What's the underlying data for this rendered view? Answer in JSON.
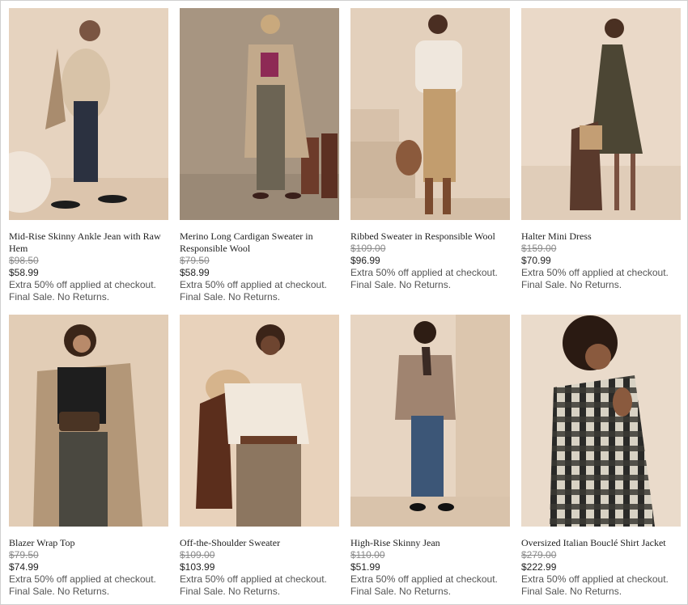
{
  "products": [
    {
      "name": "Mid-Rise Skinny Ankle Jean with Raw Hem",
      "original_price": "$98.50",
      "sale_price": "$58.99",
      "promo": "Extra 50% off applied at checkout.",
      "final": "Final Sale. No Returns.",
      "bg": "#e6d3bf",
      "figure": "#b99a7b"
    },
    {
      "name": "Merino Long Cardigan Sweater in Responsible Wool",
      "original_price": "$79.50",
      "sale_price": "$58.99",
      "promo": "Extra 50% off applied at checkout.",
      "final": "Final Sale. No Returns.",
      "bg": "#a79581",
      "figure": "#c2a98b"
    },
    {
      "name": "Ribbed Sweater in Responsible Wool",
      "original_price": "$109.00",
      "sale_price": "$96.99",
      "promo": "Extra 50% off applied at checkout.",
      "final": "Final Sale. No Returns.",
      "bg": "#e3d0bc",
      "figure": "#efe7dd"
    },
    {
      "name": "Halter Mini Dress",
      "original_price": "$159.00",
      "sale_price": "$70.99",
      "promo": "Extra 50% off applied at checkout.",
      "final": "Final Sale. No Returns.",
      "bg": "#ead9c8",
      "figure": "#4c4634"
    },
    {
      "name": "Blazer Wrap Top",
      "original_price": "$79.50",
      "sale_price": "$74.99",
      "promo": "Extra 50% off applied at checkout.",
      "final": "Final Sale. No Returns.",
      "bg": "#e2cdb6",
      "figure": "#b39778"
    },
    {
      "name": "Off-the-Shoulder Sweater",
      "original_price": "$109.00",
      "sale_price": "$103.99",
      "promo": "Extra 50% off applied at checkout.",
      "final": "Final Sale. No Returns.",
      "bg": "#e8d2bb",
      "figure": "#f1e8dc"
    },
    {
      "name": "High-Rise Skinny Jean",
      "original_price": "$110.00",
      "sale_price": "$51.99",
      "promo": "Extra 50% off applied at checkout.",
      "final": "Final Sale. No Returns.",
      "bg": "#e7d5c2",
      "figure": "#3c5677"
    },
    {
      "name": "Oversized Italian Bouclé Shirt Jacket",
      "original_price": "$279.00",
      "sale_price": "$222.99",
      "promo": "Extra 50% off applied at checkout.",
      "final": "Final Sale. No Returns.",
      "bg": "#eadbcb",
      "figure": "#5b5a52"
    }
  ]
}
